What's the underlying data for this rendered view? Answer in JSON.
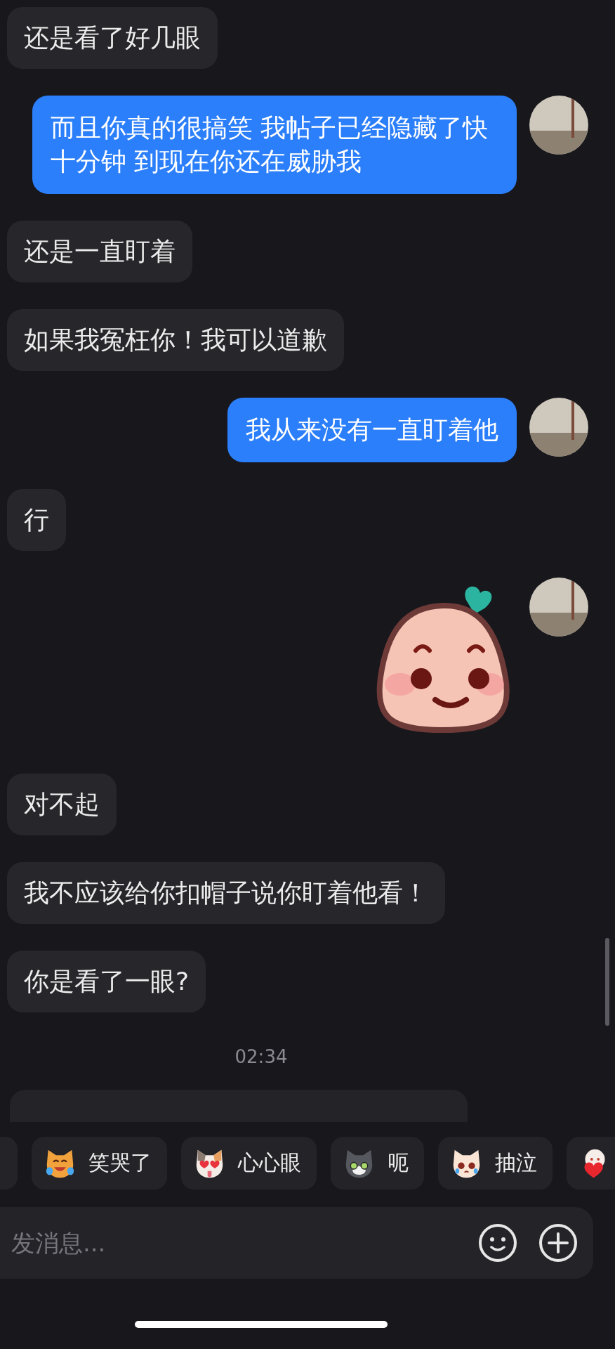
{
  "messages": [
    {
      "kind": "text",
      "sent": false,
      "text": "还是看了好几眼"
    },
    {
      "kind": "text",
      "sent": true,
      "text": "而且你真的很搞笑 我帖子已经隐藏了快十分钟 到现在你还在威胁我"
    },
    {
      "kind": "text",
      "sent": false,
      "text": "还是一直盯着"
    },
    {
      "kind": "text",
      "sent": false,
      "text": "如果我冤枉你！我可以道歉"
    },
    {
      "kind": "text",
      "sent": true,
      "text": "我从来没有一直盯着他"
    },
    {
      "kind": "text",
      "sent": false,
      "text": "行"
    },
    {
      "kind": "sticker",
      "sent": true
    },
    {
      "kind": "text",
      "sent": false,
      "text": "对不起"
    },
    {
      "kind": "text",
      "sent": false,
      "text": "我不应该给你扣帽子说你盯着他看！"
    },
    {
      "kind": "text",
      "sent": false,
      "text": "你是看了一眼?"
    },
    {
      "kind": "time",
      "text": "02:34"
    },
    {
      "kind": "cut-off",
      "sent": false
    }
  ],
  "quick_stickers": [
    {
      "kind": "laughing-cat",
      "label": "笑哭了"
    },
    {
      "kind": "heart-eyes-dog",
      "label": "心心眼"
    },
    {
      "kind": "tuxedo-cat",
      "label": "呃"
    },
    {
      "kind": "teary-cat",
      "label": "抽泣"
    },
    {
      "kind": "heart-hug"
    }
  ],
  "composer": {
    "placeholder": "发消息..."
  }
}
